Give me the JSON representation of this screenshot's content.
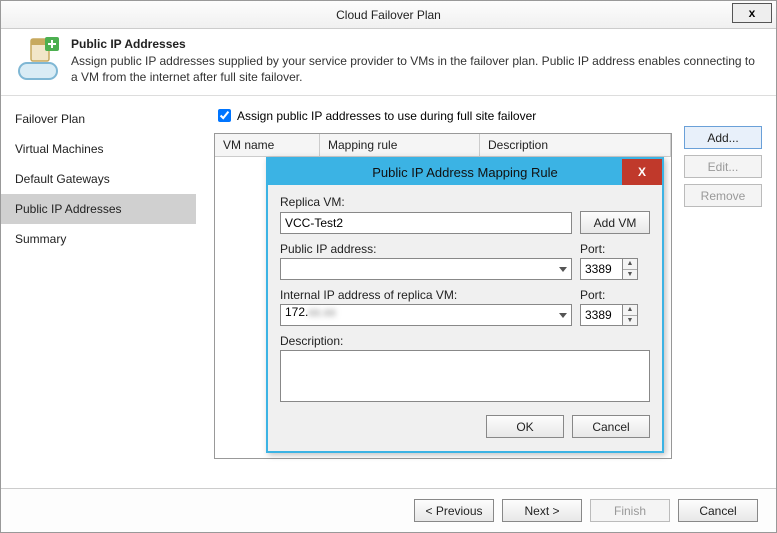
{
  "window": {
    "title": "Cloud Failover Plan",
    "close_glyph": "x"
  },
  "header": {
    "title": "Public IP Addresses",
    "desc": "Assign public IP addresses supplied by your service provider to VMs in the failover plan. Public IP address enables connecting to a VM from the internet after full site failover."
  },
  "sidebar": {
    "items": [
      {
        "label": "Failover Plan"
      },
      {
        "label": "Virtual Machines"
      },
      {
        "label": "Default Gateways"
      },
      {
        "label": "Public IP Addresses"
      },
      {
        "label": "Summary"
      }
    ],
    "selected_index": 3
  },
  "main": {
    "checkbox_label": "Assign public IP addresses to use during full site failover",
    "checkbox_checked": true,
    "columns": {
      "vm": "VM name",
      "map": "Mapping rule",
      "desc": "Description"
    },
    "buttons": {
      "add": "Add...",
      "edit": "Edit...",
      "remove": "Remove"
    }
  },
  "footer": {
    "prev": "< Previous",
    "next": "Next >",
    "finish": "Finish",
    "cancel": "Cancel"
  },
  "modal": {
    "title": "Public IP Address Mapping Rule",
    "close_glyph": "X",
    "replica_label": "Replica VM:",
    "replica_value": "VCC-Test2",
    "add_vm": "Add VM",
    "public_ip_label": "Public IP address:",
    "public_ip_value": "",
    "public_port_label": "Port:",
    "public_port_value": "3389",
    "internal_ip_label": "Internal IP address of replica VM:",
    "internal_ip_value": "172.",
    "internal_port_label": "Port:",
    "internal_port_value": "3389",
    "description_label": "Description:",
    "description_value": "",
    "ok": "OK",
    "cancel": "Cancel"
  }
}
